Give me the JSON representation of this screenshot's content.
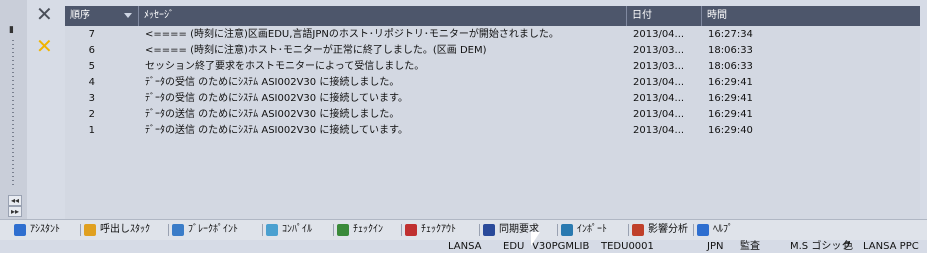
{
  "columns": {
    "seq": "順序",
    "message": "ﾒｯｾｰｼﾞ",
    "date": "日付",
    "time": "時間"
  },
  "rows": [
    {
      "seq": "7",
      "message": "<==== (時刻に注意)区画EDU,言語JPNのホスト･リポジトリ･モニターが開始されました。",
      "date": "2013/04...",
      "time": "16:27:34"
    },
    {
      "seq": "6",
      "message": "<==== (時刻に注意)ホスト･モニターが正常に終了しました。(区画 DEM)",
      "date": "2013/03...",
      "time": "18:06:33"
    },
    {
      "seq": "5",
      "message": "セッション終了要求をホストモニターによって受信しました。",
      "date": "2013/03...",
      "time": "18:06:33"
    },
    {
      "seq": "4",
      "message": "ﾃﾞｰﾀの受信 のためにｼｽﾃﾑ ASI002V30 に接続しました。",
      "date": "2013/04...",
      "time": "16:29:41"
    },
    {
      "seq": "3",
      "message": "ﾃﾞｰﾀの受信 のためにｼｽﾃﾑ ASI002V30 に接続しています。",
      "date": "2013/04...",
      "time": "16:29:41"
    },
    {
      "seq": "2",
      "message": "ﾃﾞｰﾀの送信 のためにｼｽﾃﾑ ASI002V30 に接続しました。",
      "date": "2013/04...",
      "time": "16:29:41"
    },
    {
      "seq": "1",
      "message": "ﾃﾞｰﾀの送信 のためにｼｽﾃﾑ ASI002V30 に接続しています。",
      "date": "2013/04...",
      "time": "16:29:40"
    }
  ],
  "toolbar": [
    {
      "label": "ｱｼｽﾀﾝﾄ",
      "icon": "info-icon",
      "color": "#2f6fd0"
    },
    {
      "label": "呼出しｽﾀｯｸ",
      "icon": "call-stack-icon",
      "color": "#e0a020"
    },
    {
      "label": "ﾌﾞﾚｰｸﾎﾟｲﾝﾄ",
      "icon": "breakpoint-icon",
      "color": "#3a7cc8"
    },
    {
      "label": "ｺﾝﾊﾟｲﾙ",
      "icon": "compile-icon",
      "color": "#4aa0d0"
    },
    {
      "label": "ﾁｪｯｸｲﾝ",
      "icon": "checkin-icon",
      "color": "#3a8a3a"
    },
    {
      "label": "ﾁｪｯｸｱｳﾄ",
      "icon": "checkout-icon",
      "color": "#c03030"
    },
    {
      "label": "同期要求",
      "icon": "sync-icon",
      "color": "#2a4a9a"
    },
    {
      "label": "ｲﾝﾎﾟｰﾄ",
      "icon": "import-icon",
      "color": "#2a7ab0"
    },
    {
      "label": "影響分析",
      "icon": "impact-analysis-icon",
      "color": "#c0402a"
    },
    {
      "label": "ﾍﾙﾌﾟ",
      "icon": "help-icon",
      "color": "#2f6fd0"
    }
  ],
  "statusbar": [
    "LANSA",
    "EDU",
    "V30PGMLIB",
    "TEDU0001",
    "JPN",
    "監査",
    "M.S ゴシック",
    "色",
    "LANSA PPC"
  ]
}
